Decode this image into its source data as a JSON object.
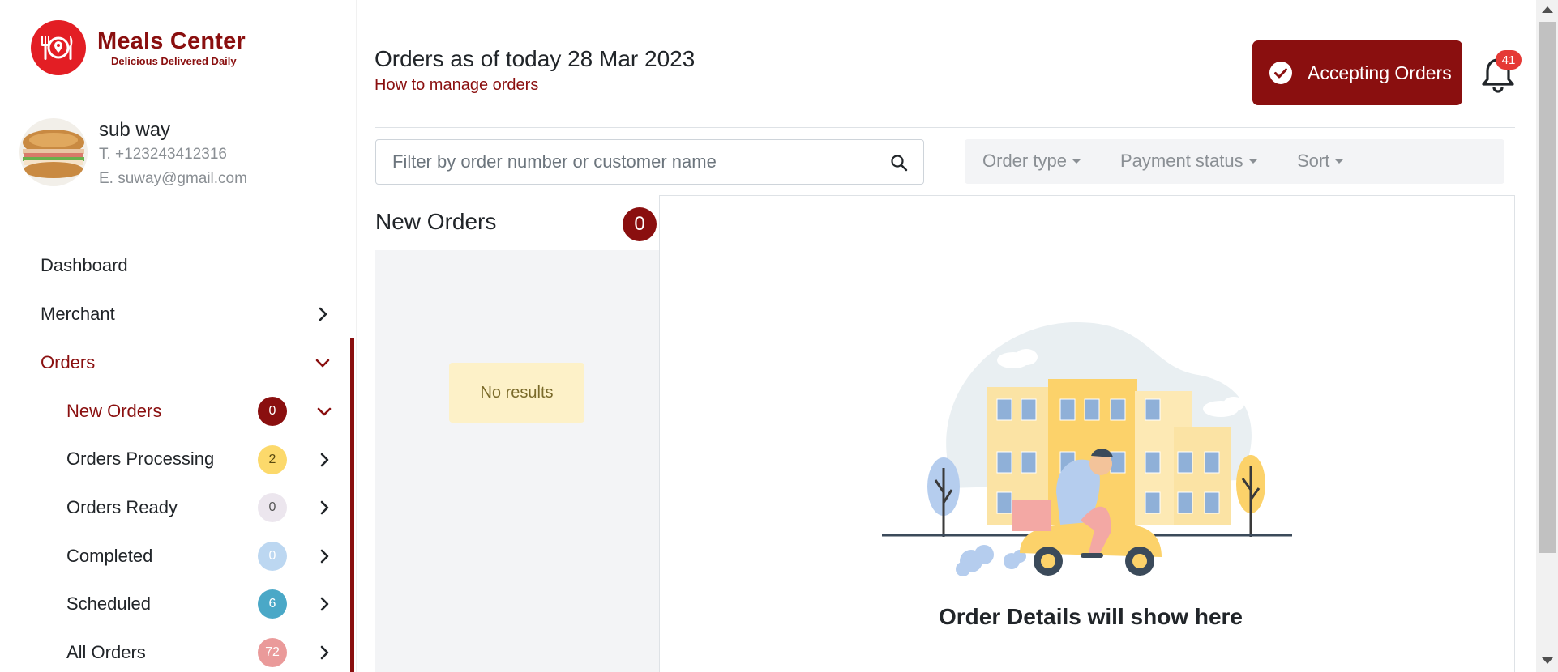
{
  "brand": {
    "name": "Meals Center",
    "tagline": "Delicious Delivered Daily"
  },
  "profile": {
    "name": "sub way",
    "phone": "T. +123243412316",
    "email": "E. suway@gmail.com"
  },
  "nav": {
    "dashboard": "Dashboard",
    "merchant": "Merchant",
    "orders": "Orders",
    "order_items": [
      {
        "label": "New Orders",
        "count": "0",
        "badge_bg": "#8a0f0f",
        "badge_fg": "#ffffff"
      },
      {
        "label": "Orders Processing",
        "count": "2",
        "badge_bg": "#fcd96b",
        "badge_fg": "#5a4a10"
      },
      {
        "label": "Orders Ready",
        "count": "0",
        "badge_bg": "#ece6ee",
        "badge_fg": "#555555"
      },
      {
        "label": "Completed",
        "count": "0",
        "badge_bg": "#bcd7f1",
        "badge_fg": "#ffffff"
      },
      {
        "label": "Scheduled",
        "count": "6",
        "badge_bg": "#4aa8c7",
        "badge_fg": "#ffffff"
      },
      {
        "label": "All Orders",
        "count": "72",
        "badge_bg": "#ea9a9a",
        "badge_fg": "#ffffff"
      }
    ]
  },
  "header": {
    "title": "Orders as of today 28 Mar 2023",
    "help_link": "How to manage orders",
    "accept_label": "Accepting Orders",
    "notification_count": "41"
  },
  "search": {
    "placeholder": "Filter by order number or customer name",
    "value": ""
  },
  "filters": {
    "order_type": "Order type",
    "payment_status": "Payment status",
    "sort": "Sort"
  },
  "orders_panel": {
    "title": "New Orders",
    "count": "0",
    "empty_text": "No results"
  },
  "details": {
    "placeholder_text": "Order Details will show here"
  },
  "icons": [
    "logo-icon",
    "avatar",
    "chevron-right-icon",
    "chevron-down-icon",
    "check-circle-icon",
    "bell-icon",
    "search-icon",
    "caret-down-icon",
    "delivery-illustration"
  ],
  "colors": {
    "brand": "#8a0f0f",
    "brand_red": "#e31e24",
    "notification": "#e53935",
    "panel_bg": "#f3f4f6",
    "empty_bg": "#fdf1c8"
  }
}
